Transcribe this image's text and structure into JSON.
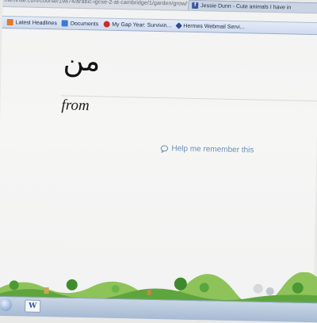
{
  "browser": {
    "url": "memrise.com/course/19874/arabic-igcse-2-at-cambridge/1/garden/grow/",
    "active_tab": "Jessie Dunn - Cute animals I have in",
    "tab_close": "x"
  },
  "bookmarks": [
    {
      "label": "Latest Headlines",
      "icon": "rss-icon",
      "color": "#e07b2a"
    },
    {
      "label": "Documents",
      "icon": "documents-icon",
      "color": "#3a7bd5"
    },
    {
      "label": "My Gap Year: Survivin...",
      "icon": "youtube-icon",
      "color": "#cc2b2b"
    },
    {
      "label": "Hermes Webmail Servi...",
      "icon": "webmail-icon",
      "color": "#2a4c8f"
    }
  ],
  "card": {
    "word": "من",
    "translation": "from",
    "help_link": "Help me remember this"
  },
  "taskbar": {
    "word_label": "W"
  },
  "colors": {
    "link": "#6f8fb9",
    "page_bg": "#f4f5f4",
    "bookmarks_bar": "#cfdbef"
  }
}
